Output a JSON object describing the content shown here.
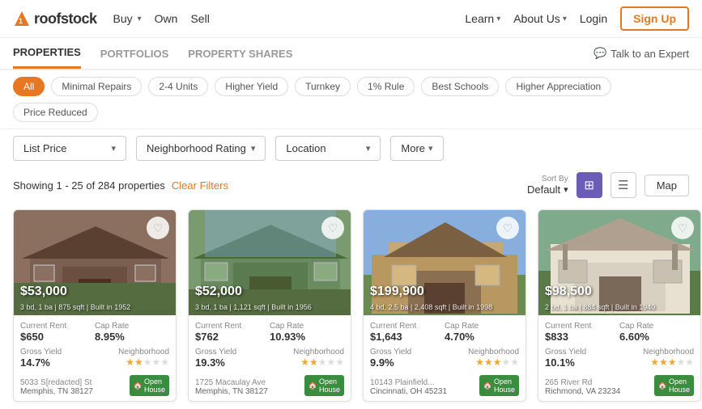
{
  "header": {
    "logo_text": "roofstock",
    "nav": [
      {
        "label": "Buy",
        "has_dropdown": true
      },
      {
        "label": "Own",
        "has_dropdown": false
      },
      {
        "label": "Sell",
        "has_dropdown": false
      }
    ],
    "right_nav": [
      {
        "label": "Learn",
        "has_dropdown": true
      },
      {
        "label": "About Us",
        "has_dropdown": true
      }
    ],
    "login_label": "Login",
    "signup_label": "Sign Up"
  },
  "sub_nav": {
    "items": [
      "PROPERTIES",
      "PORTFOLIOS",
      "PROPERTY SHARES"
    ],
    "active": "PROPERTIES",
    "talk_label": "Talk to an Expert"
  },
  "filters": {
    "chips": [
      {
        "label": "All",
        "active": true
      },
      {
        "label": "Minimal Repairs",
        "active": false
      },
      {
        "label": "2-4 Units",
        "active": false
      },
      {
        "label": "Higher Yield",
        "active": false
      },
      {
        "label": "Turnkey",
        "active": false
      },
      {
        "label": "1% Rule",
        "active": false
      },
      {
        "label": "Best Schools",
        "active": false
      },
      {
        "label": "Higher Appreciation",
        "active": false
      },
      {
        "label": "Price Reduced",
        "active": false
      }
    ]
  },
  "dropdowns": [
    {
      "label": "List Price"
    },
    {
      "label": "Neighborhood Rating"
    },
    {
      "label": "Location"
    },
    {
      "label": "More"
    }
  ],
  "results": {
    "text": "Showing 1 - 25 of 284 properties",
    "clear_filters": "Clear Filters",
    "sort_label": "Sort By",
    "sort_value": "Default",
    "map_label": "Map"
  },
  "properties": [
    {
      "price": "$53,000",
      "specs": "3 bd, 1 ba | 875 sqft | Built in 1952",
      "current_rent_label": "Current Rent",
      "current_rent": "$650",
      "cap_rate_label": "Cap Rate",
      "cap_rate": "8.95%",
      "gross_yield_label": "Gross Yield",
      "gross_yield": "14.7%",
      "neighborhood_label": "Neighborhood",
      "stars": 2,
      "total_stars": 5,
      "address_line1": "5033 S[redacted] St",
      "address_line2": "Memphis, TN 38127",
      "open_house": true,
      "bg_color": "#8B6F5E"
    },
    {
      "price": "$52,000",
      "specs": "3 bd, 1 ba | 1,121 sqft | Built in 1956",
      "current_rent_label": "Current Rent",
      "current_rent": "$762",
      "cap_rate_label": "Cap Rate",
      "cap_rate": "10.93%",
      "gross_yield_label": "Gross Yield",
      "gross_yield": "19.3%",
      "neighborhood_label": "Neighborhood",
      "stars": 2,
      "total_stars": 5,
      "address_line1": "1725 Macaulay Ave",
      "address_line2": "Memphis, TN 38127",
      "open_house": true,
      "bg_color": "#7A9B6A"
    },
    {
      "price": "$199,900",
      "specs": "4 bd, 2.5 ba | 2,408 sqft | Built in 1998",
      "current_rent_label": "Current Rent",
      "current_rent": "$1,643",
      "cap_rate_label": "Cap Rate",
      "cap_rate": "4.70%",
      "gross_yield_label": "Gross Yield",
      "gross_yield": "9.9%",
      "neighborhood_label": "Neighborhood",
      "stars": 3,
      "total_stars": 5,
      "address_line1": "10143 Plainfield...",
      "address_line2": "Cincinnati, OH 45231",
      "open_house": true,
      "bg_color": "#C4A265"
    },
    {
      "price": "$98,500",
      "specs": "2 bd, 1 ba | 884 sqft | Built in 1940",
      "current_rent_label": "Current Rent",
      "current_rent": "$833",
      "cap_rate_label": "Cap Rate",
      "cap_rate": "6.60%",
      "gross_yield_label": "Gross Yield",
      "gross_yield": "10.1%",
      "neighborhood_label": "Neighborhood",
      "stars": 3,
      "total_stars": 5,
      "address_line1": "265 River Rd",
      "address_line2": "Richmond, VA 23234",
      "open_house": true,
      "bg_color": "#7FAB8C"
    }
  ]
}
